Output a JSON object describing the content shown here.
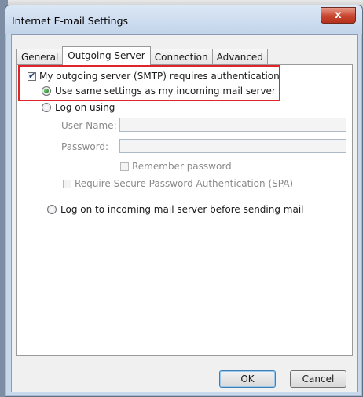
{
  "window": {
    "title": "Internet E-mail Settings",
    "close_symbol": "x"
  },
  "tabs": [
    {
      "label": "General",
      "active": false
    },
    {
      "label": "Outgoing Server",
      "active": true
    },
    {
      "label": "Connection",
      "active": false
    },
    {
      "label": "Advanced",
      "active": false
    }
  ],
  "outgoing": {
    "requires_auth": {
      "label": "My outgoing server (SMTP) requires authentication",
      "checked": true
    },
    "use_same_settings": {
      "label": "Use same settings as my incoming mail server",
      "selected": true
    },
    "log_on_using": {
      "label": "Log on using",
      "selected": false
    },
    "user_name": {
      "label": "User Name:",
      "value": ""
    },
    "password": {
      "label": "Password:",
      "value": ""
    },
    "remember_password": {
      "label": "Remember password",
      "checked": false,
      "enabled": false
    },
    "require_spa": {
      "label": "Require Secure Password Authentication (SPA)",
      "checked": false,
      "enabled": false
    },
    "log_on_incoming_first": {
      "label": "Log on to incoming mail server before sending mail",
      "selected": false
    }
  },
  "buttons": {
    "ok": "OK",
    "cancel": "Cancel"
  },
  "colors": {
    "highlight_box": "#e0242b",
    "radio_selected": "#2e8b2e",
    "checkbox_mark": "#2c3f74"
  }
}
